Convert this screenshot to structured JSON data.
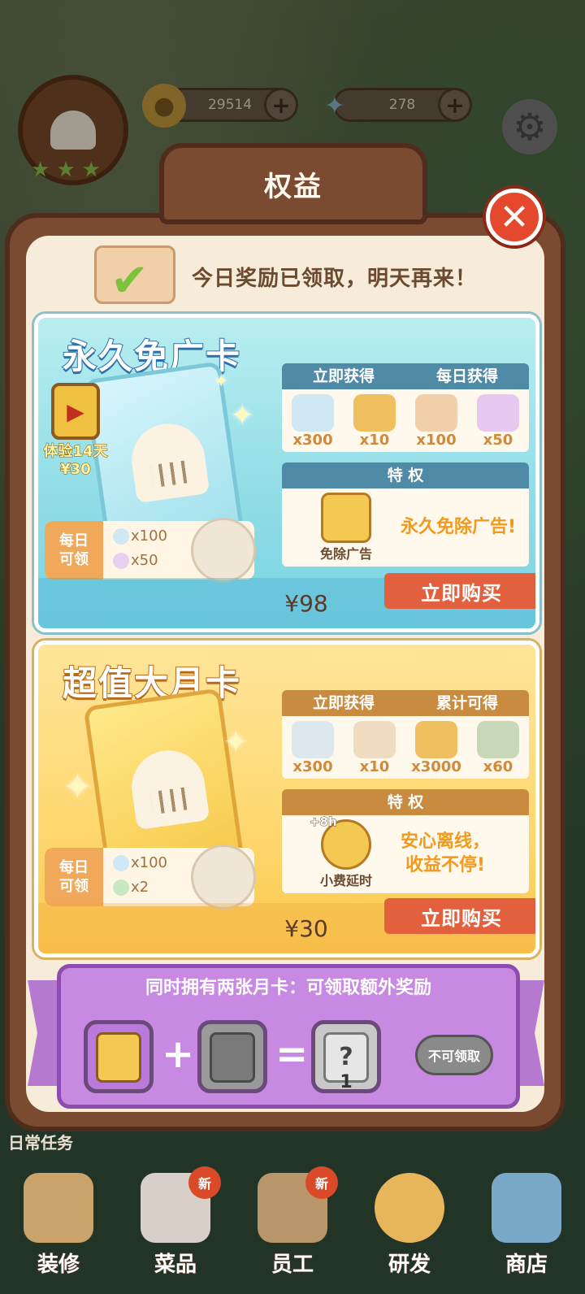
{
  "hud": {
    "coins": "29514",
    "gems": "278"
  },
  "modal": {
    "title": "权益",
    "notice": "今日奖励已领取，明天再来！"
  },
  "ad_free_card": {
    "title": "永久免广卡",
    "trial_label": "体验14天",
    "trial_price": "¥30",
    "instant_header": "立即获得",
    "daily_header": "每日获得",
    "instant_items": [
      {
        "qty": "x300"
      },
      {
        "qty": "x10"
      }
    ],
    "daily_items": [
      {
        "qty": "x100"
      },
      {
        "qty": "x50"
      }
    ],
    "privilege_header": "特 权",
    "privilege_icon_label": "免除广告",
    "privilege_text": "永久免除广告!",
    "daily_claim_label": "每日\n可领",
    "daily_claim_rows": [
      "x100",
      "x50"
    ],
    "price": "¥98",
    "buy_label": "立即购买"
  },
  "monthly_card": {
    "title": "超值大月卡",
    "instant_header": "立即获得",
    "total_header": "累计可得",
    "instant_items": [
      {
        "qty": "x300"
      },
      {
        "qty": "x10"
      }
    ],
    "total_items": [
      {
        "qty": "x3000"
      },
      {
        "qty": "x60"
      }
    ],
    "privilege_header": "特 权",
    "privilege_badge": "+8h",
    "privilege_icon_label": "小费延时",
    "privilege_text": "安心离线，\n收益不停!",
    "daily_claim_label": "每日\n可领",
    "daily_claim_rows": [
      "x100",
      "x2"
    ],
    "price": "¥30",
    "buy_label": "立即购买"
  },
  "combo": {
    "title": "同时拥有两张月卡：可领取额外奖励",
    "plus": "+",
    "equals": "=",
    "reward_count": "1",
    "claim_label": "不可领取"
  },
  "bottom": {
    "daily_tasks": "日常任务",
    "nav": [
      {
        "label": "装修",
        "new": ""
      },
      {
        "label": "菜品",
        "new": "新"
      },
      {
        "label": "员工",
        "new": "新"
      },
      {
        "label": "研发",
        "new": ""
      },
      {
        "label": "商店",
        "new": ""
      }
    ]
  }
}
